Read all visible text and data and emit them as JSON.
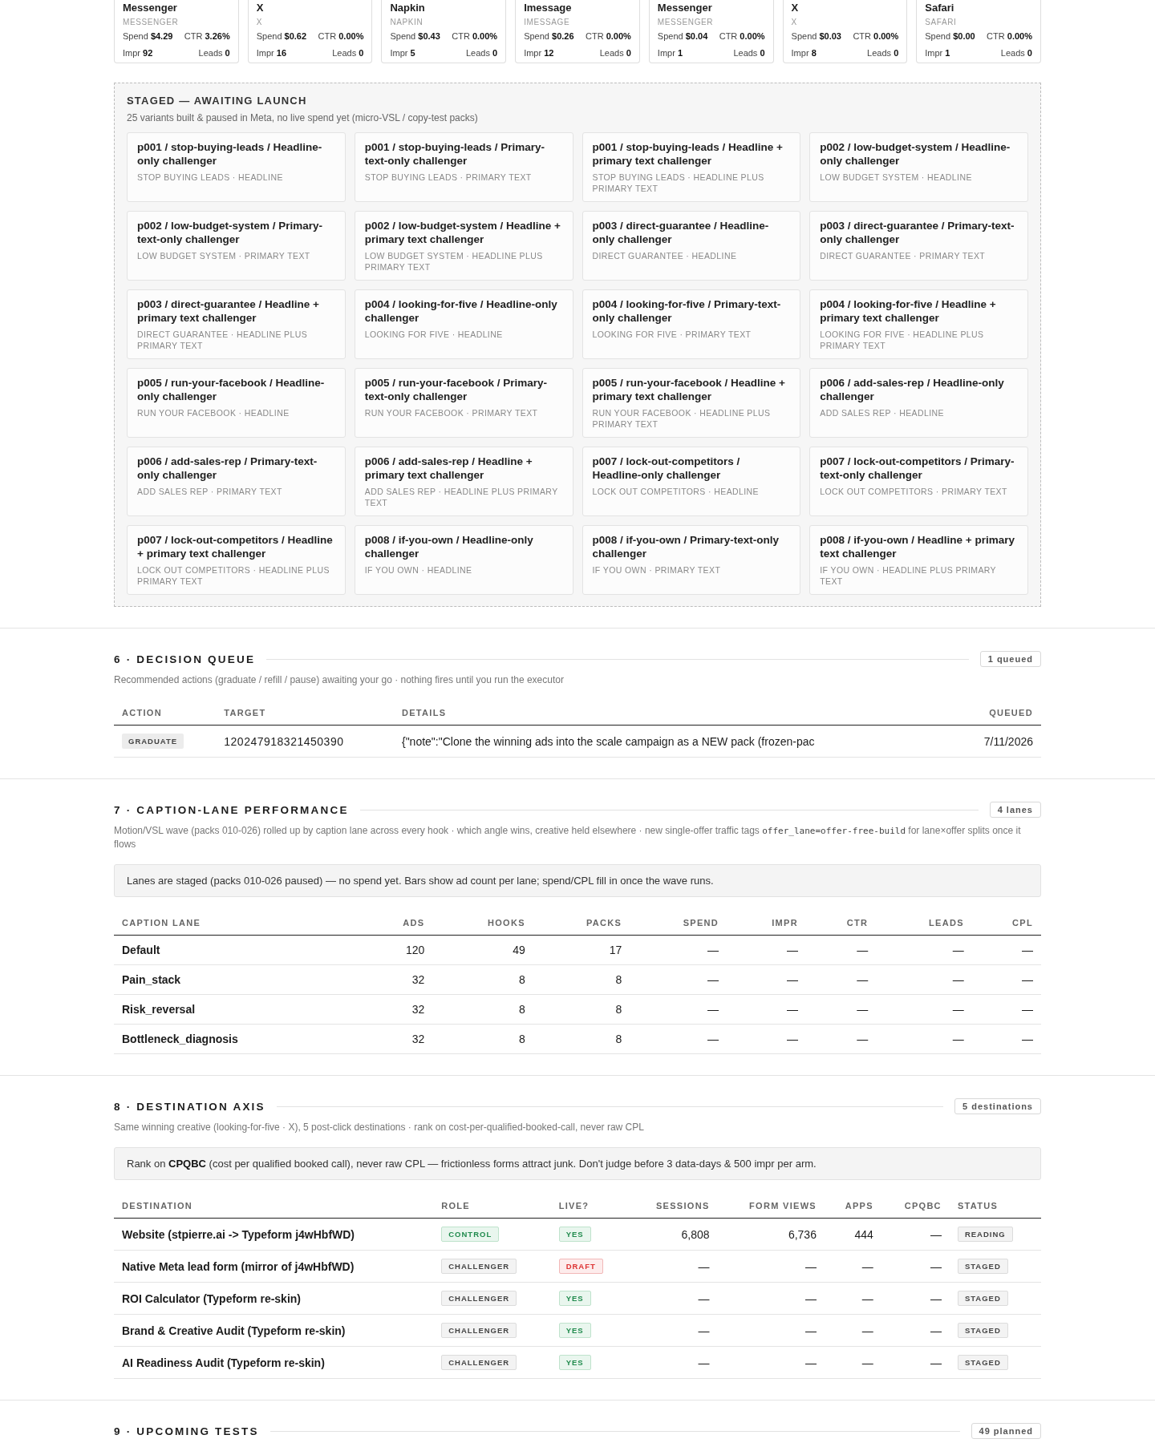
{
  "top_cards": [
    {
      "title": "Messenger",
      "platform": "MESSENGER",
      "metrics": [
        {
          "label": "Spend",
          "value": "$4.29"
        },
        {
          "label": "CTR",
          "value": "3.26%"
        },
        {
          "label": "Impr",
          "value": "92"
        },
        {
          "label": "Leads",
          "value": "0"
        }
      ]
    },
    {
      "title": "X",
      "platform": "X",
      "metrics": [
        {
          "label": "Spend",
          "value": "$0.62"
        },
        {
          "label": "CTR",
          "value": "0.00%"
        },
        {
          "label": "Impr",
          "value": "16"
        },
        {
          "label": "Leads",
          "value": "0"
        }
      ]
    },
    {
      "title": "Napkin",
      "platform": "NAPKIN",
      "metrics": [
        {
          "label": "Spend",
          "value": "$0.43"
        },
        {
          "label": "CTR",
          "value": "0.00%"
        },
        {
          "label": "Impr",
          "value": "5"
        },
        {
          "label": "Leads",
          "value": "0"
        }
      ]
    },
    {
      "title": "Imessage",
      "platform": "IMESSAGE",
      "metrics": [
        {
          "label": "Spend",
          "value": "$0.26"
        },
        {
          "label": "CTR",
          "value": "0.00%"
        },
        {
          "label": "Impr",
          "value": "12"
        },
        {
          "label": "Leads",
          "value": "0"
        }
      ]
    },
    {
      "title": "Messenger",
      "platform": "MESSENGER",
      "metrics": [
        {
          "label": "Spend",
          "value": "$0.04"
        },
        {
          "label": "CTR",
          "value": "0.00%"
        },
        {
          "label": "Impr",
          "value": "1"
        },
        {
          "label": "Leads",
          "value": "0"
        }
      ]
    },
    {
      "title": "X",
      "platform": "X",
      "metrics": [
        {
          "label": "Spend",
          "value": "$0.03"
        },
        {
          "label": "CTR",
          "value": "0.00%"
        },
        {
          "label": "Impr",
          "value": "8"
        },
        {
          "label": "Leads",
          "value": "0"
        }
      ]
    },
    {
      "title": "Safari",
      "platform": "SAFARI",
      "metrics": [
        {
          "label": "Spend",
          "value": "$0.00"
        },
        {
          "label": "CTR",
          "value": "0.00%"
        },
        {
          "label": "Impr",
          "value": "1"
        },
        {
          "label": "Leads",
          "value": "0"
        }
      ]
    }
  ],
  "staged": {
    "title": "STAGED — AWAITING LAUNCH",
    "subtitle": "25 variants built & paused in Meta, no live spend yet (micro-VSL / copy-test packs)",
    "variants": [
      {
        "title": "p001 / stop-buying-leads / Headline-only challenger",
        "tags": "STOP BUYING LEADS · HEADLINE"
      },
      {
        "title": "p001 / stop-buying-leads / Primary-text-only challenger",
        "tags": "STOP BUYING LEADS · PRIMARY TEXT"
      },
      {
        "title": "p001 / stop-buying-leads / Headline + primary text challenger",
        "tags": "STOP BUYING LEADS · HEADLINE PLUS PRIMARY TEXT"
      },
      {
        "title": "p002 / low-budget-system / Headline-only challenger",
        "tags": "LOW BUDGET SYSTEM · HEADLINE"
      },
      {
        "title": "p002 / low-budget-system / Primary-text-only challenger",
        "tags": "LOW BUDGET SYSTEM · PRIMARY TEXT"
      },
      {
        "title": "p002 / low-budget-system / Headline + primary text challenger",
        "tags": "LOW BUDGET SYSTEM · HEADLINE PLUS PRIMARY TEXT"
      },
      {
        "title": "p003 / direct-guarantee / Headline-only challenger",
        "tags": "DIRECT GUARANTEE · HEADLINE"
      },
      {
        "title": "p003 / direct-guarantee / Primary-text-only challenger",
        "tags": "DIRECT GUARANTEE · PRIMARY TEXT"
      },
      {
        "title": "p003 / direct-guarantee / Headline + primary text challenger",
        "tags": "DIRECT GUARANTEE · HEADLINE PLUS PRIMARY TEXT"
      },
      {
        "title": "p004 / looking-for-five / Headline-only challenger",
        "tags": "LOOKING FOR FIVE · HEADLINE"
      },
      {
        "title": "p004 / looking-for-five / Primary-text-only challenger",
        "tags": "LOOKING FOR FIVE · PRIMARY TEXT"
      },
      {
        "title": "p004 / looking-for-five / Headline + primary text challenger",
        "tags": "LOOKING FOR FIVE · HEADLINE PLUS PRIMARY TEXT"
      },
      {
        "title": "p005 / run-your-facebook / Headline-only challenger",
        "tags": "RUN YOUR FACEBOOK · HEADLINE"
      },
      {
        "title": "p005 / run-your-facebook / Primary-text-only challenger",
        "tags": "RUN YOUR FACEBOOK · PRIMARY TEXT"
      },
      {
        "title": "p005 / run-your-facebook / Headline + primary text challenger",
        "tags": "RUN YOUR FACEBOOK · HEADLINE PLUS PRIMARY TEXT"
      },
      {
        "title": "p006 / add-sales-rep / Headline-only challenger",
        "tags": "ADD SALES REP · HEADLINE"
      },
      {
        "title": "p006 / add-sales-rep / Primary-text-only challenger",
        "tags": "ADD SALES REP · PRIMARY TEXT"
      },
      {
        "title": "p006 / add-sales-rep / Headline + primary text challenger",
        "tags": "ADD SALES REP · HEADLINE PLUS PRIMARY TEXT"
      },
      {
        "title": "p007 / lock-out-competitors / Headline-only challenger",
        "tags": "LOCK OUT COMPETITORS · HEADLINE"
      },
      {
        "title": "p007 / lock-out-competitors / Primary-text-only challenger",
        "tags": "LOCK OUT COMPETITORS · PRIMARY TEXT"
      },
      {
        "title": "p007 / lock-out-competitors / Headline + primary text challenger",
        "tags": "LOCK OUT COMPETITORS · HEADLINE PLUS PRIMARY TEXT"
      },
      {
        "title": "p008 / if-you-own / Headline-only challenger",
        "tags": "IF YOU OWN · HEADLINE"
      },
      {
        "title": "p008 / if-you-own / Primary-text-only challenger",
        "tags": "IF YOU OWN · PRIMARY TEXT"
      },
      {
        "title": "p008 / if-you-own / Headline + primary text challenger",
        "tags": "IF YOU OWN · HEADLINE PLUS PRIMARY TEXT"
      }
    ]
  },
  "decision_queue": {
    "title": "6 · DECISION QUEUE",
    "count": "1 queued",
    "subtitle": "Recommended actions (graduate / refill / pause) awaiting your go · nothing fires until you run the executor",
    "columns": [
      "ACTION",
      "TARGET",
      "DETAILS",
      "QUEUED"
    ],
    "rows": [
      {
        "action": "GRADUATE",
        "target": "120247918321450390",
        "details": "{\"note\":\"Clone the winning ads into the scale campaign as a NEW pack (frozen-pac",
        "queued": "7/11/2026"
      }
    ]
  },
  "caption_lanes": {
    "title": "7 · CAPTION-LANE PERFORMANCE",
    "count": "4 lanes",
    "subtitle": [
      {
        "kind": "text",
        "text": "Motion/VSL wave (packs 010-026) rolled up by caption lane across every hook · which angle wins, creative held elsewhere · new single-offer traffic tags "
      },
      {
        "kind": "code",
        "text": "offer_lane=offer-free-build"
      },
      {
        "kind": "text",
        "text": " for lane×offer splits once it flows"
      }
    ],
    "notice": "Lanes are staged (packs 010-026 paused) — no spend yet. Bars show ad count per lane; spend/CPL fill in once the wave runs.",
    "columns": [
      "CAPTION LANE",
      "ADS",
      "HOOKS",
      "PACKS",
      "SPEND",
      "IMPR",
      "CTR",
      "LEADS",
      "CPL"
    ],
    "rows": [
      [
        "Default",
        "120",
        "49",
        "17",
        "—",
        "—",
        "—",
        "—",
        "—"
      ],
      [
        "Pain_stack",
        "32",
        "8",
        "8",
        "—",
        "—",
        "—",
        "—",
        "—"
      ],
      [
        "Risk_reversal",
        "32",
        "8",
        "8",
        "—",
        "—",
        "—",
        "—",
        "—"
      ],
      [
        "Bottleneck_diagnosis",
        "32",
        "8",
        "8",
        "—",
        "—",
        "—",
        "—",
        "—"
      ]
    ]
  },
  "destination_axis": {
    "title": "8 · DESTINATION AXIS",
    "count": "5 destinations",
    "subtitle": "Same winning creative (looking-for-five · X), 5 post-click destinations · rank on cost-per-qualified-booked-call, never raw CPL",
    "notice": "Rank on **CPQBC** (cost per qualified booked call), never raw CPL — frictionless forms attract junk. Don't judge before 3 data-days & 500 impr per arm.",
    "columns": [
      "DESTINATION",
      "ROLE",
      "LIVE?",
      "SESSIONS",
      "FORM VIEWS",
      "APPS",
      "CPQBC",
      "STATUS"
    ],
    "rows": [
      {
        "destination": "Website (stpierre.ai -> Typeform j4wHbfWD)",
        "role": {
          "text": "CONTROL",
          "kind": "control"
        },
        "live": {
          "text": "YES",
          "kind": "yes"
        },
        "sessions": "6,808",
        "form_views": "6,736",
        "apps": "444",
        "cpqbc": "—",
        "status": "READING"
      },
      {
        "destination": "Native Meta lead form (mirror of j4wHbfWD)",
        "role": {
          "text": "CHALLENGER",
          "kind": "challenger"
        },
        "live": {
          "text": "DRAFT",
          "kind": "draft"
        },
        "sessions": "—",
        "form_views": "—",
        "apps": "—",
        "cpqbc": "—",
        "status": "STAGED"
      },
      {
        "destination": "ROI Calculator (Typeform re-skin)",
        "role": {
          "text": "CHALLENGER",
          "kind": "challenger"
        },
        "live": {
          "text": "YES",
          "kind": "yes"
        },
        "sessions": "—",
        "form_views": "—",
        "apps": "—",
        "cpqbc": "—",
        "status": "STAGED"
      },
      {
        "destination": "Brand & Creative Audit (Typeform re-skin)",
        "role": {
          "text": "CHALLENGER",
          "kind": "challenger"
        },
        "live": {
          "text": "YES",
          "kind": "yes"
        },
        "sessions": "—",
        "form_views": "—",
        "apps": "—",
        "cpqbc": "—",
        "status": "STAGED"
      },
      {
        "destination": "AI Readiness Audit (Typeform re-skin)",
        "role": {
          "text": "CHALLENGER",
          "kind": "challenger"
        },
        "live": {
          "text": "YES",
          "kind": "yes"
        },
        "sessions": "—",
        "form_views": "—",
        "apps": "—",
        "cpqbc": "—",
        "status": "STAGED"
      }
    ]
  },
  "upcoming_tests": {
    "title": "9 · UPCOMING TESTS",
    "count": "49 planned"
  }
}
